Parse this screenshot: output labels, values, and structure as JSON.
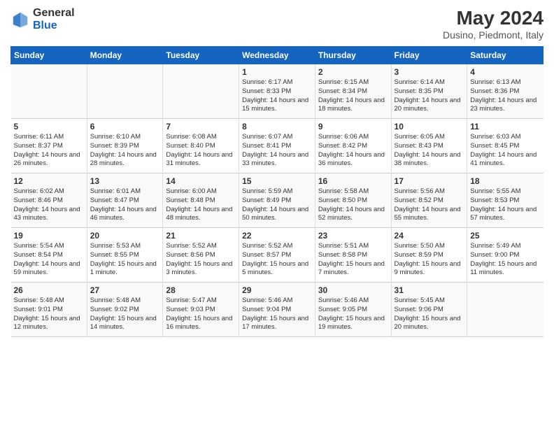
{
  "logo": {
    "general": "General",
    "blue": "Blue"
  },
  "header": {
    "month_year": "May 2024",
    "location": "Dusino, Piedmont, Italy"
  },
  "weekdays": [
    "Sunday",
    "Monday",
    "Tuesday",
    "Wednesday",
    "Thursday",
    "Friday",
    "Saturday"
  ],
  "rows": [
    [
      {
        "day": "",
        "text": ""
      },
      {
        "day": "",
        "text": ""
      },
      {
        "day": "",
        "text": ""
      },
      {
        "day": "1",
        "text": "Sunrise: 6:17 AM\nSunset: 8:33 PM\nDaylight: 14 hours\nand 15 minutes."
      },
      {
        "day": "2",
        "text": "Sunrise: 6:15 AM\nSunset: 8:34 PM\nDaylight: 14 hours\nand 18 minutes."
      },
      {
        "day": "3",
        "text": "Sunrise: 6:14 AM\nSunset: 8:35 PM\nDaylight: 14 hours\nand 20 minutes."
      },
      {
        "day": "4",
        "text": "Sunrise: 6:13 AM\nSunset: 8:36 PM\nDaylight: 14 hours\nand 23 minutes."
      }
    ],
    [
      {
        "day": "5",
        "text": "Sunrise: 6:11 AM\nSunset: 8:37 PM\nDaylight: 14 hours\nand 26 minutes."
      },
      {
        "day": "6",
        "text": "Sunrise: 6:10 AM\nSunset: 8:39 PM\nDaylight: 14 hours\nand 28 minutes."
      },
      {
        "day": "7",
        "text": "Sunrise: 6:08 AM\nSunset: 8:40 PM\nDaylight: 14 hours\nand 31 minutes."
      },
      {
        "day": "8",
        "text": "Sunrise: 6:07 AM\nSunset: 8:41 PM\nDaylight: 14 hours\nand 33 minutes."
      },
      {
        "day": "9",
        "text": "Sunrise: 6:06 AM\nSunset: 8:42 PM\nDaylight: 14 hours\nand 36 minutes."
      },
      {
        "day": "10",
        "text": "Sunrise: 6:05 AM\nSunset: 8:43 PM\nDaylight: 14 hours\nand 38 minutes."
      },
      {
        "day": "11",
        "text": "Sunrise: 6:03 AM\nSunset: 8:45 PM\nDaylight: 14 hours\nand 41 minutes."
      }
    ],
    [
      {
        "day": "12",
        "text": "Sunrise: 6:02 AM\nSunset: 8:46 PM\nDaylight: 14 hours\nand 43 minutes."
      },
      {
        "day": "13",
        "text": "Sunrise: 6:01 AM\nSunset: 8:47 PM\nDaylight: 14 hours\nand 46 minutes."
      },
      {
        "day": "14",
        "text": "Sunrise: 6:00 AM\nSunset: 8:48 PM\nDaylight: 14 hours\nand 48 minutes."
      },
      {
        "day": "15",
        "text": "Sunrise: 5:59 AM\nSunset: 8:49 PM\nDaylight: 14 hours\nand 50 minutes."
      },
      {
        "day": "16",
        "text": "Sunrise: 5:58 AM\nSunset: 8:50 PM\nDaylight: 14 hours\nand 52 minutes."
      },
      {
        "day": "17",
        "text": "Sunrise: 5:56 AM\nSunset: 8:52 PM\nDaylight: 14 hours\nand 55 minutes."
      },
      {
        "day": "18",
        "text": "Sunrise: 5:55 AM\nSunset: 8:53 PM\nDaylight: 14 hours\nand 57 minutes."
      }
    ],
    [
      {
        "day": "19",
        "text": "Sunrise: 5:54 AM\nSunset: 8:54 PM\nDaylight: 14 hours\nand 59 minutes."
      },
      {
        "day": "20",
        "text": "Sunrise: 5:53 AM\nSunset: 8:55 PM\nDaylight: 15 hours\nand 1 minute."
      },
      {
        "day": "21",
        "text": "Sunrise: 5:52 AM\nSunset: 8:56 PM\nDaylight: 15 hours\nand 3 minutes."
      },
      {
        "day": "22",
        "text": "Sunrise: 5:52 AM\nSunset: 8:57 PM\nDaylight: 15 hours\nand 5 minutes."
      },
      {
        "day": "23",
        "text": "Sunrise: 5:51 AM\nSunset: 8:58 PM\nDaylight: 15 hours\nand 7 minutes."
      },
      {
        "day": "24",
        "text": "Sunrise: 5:50 AM\nSunset: 8:59 PM\nDaylight: 15 hours\nand 9 minutes."
      },
      {
        "day": "25",
        "text": "Sunrise: 5:49 AM\nSunset: 9:00 PM\nDaylight: 15 hours\nand 11 minutes."
      }
    ],
    [
      {
        "day": "26",
        "text": "Sunrise: 5:48 AM\nSunset: 9:01 PM\nDaylight: 15 hours\nand 12 minutes."
      },
      {
        "day": "27",
        "text": "Sunrise: 5:48 AM\nSunset: 9:02 PM\nDaylight: 15 hours\nand 14 minutes."
      },
      {
        "day": "28",
        "text": "Sunrise: 5:47 AM\nSunset: 9:03 PM\nDaylight: 15 hours\nand 16 minutes."
      },
      {
        "day": "29",
        "text": "Sunrise: 5:46 AM\nSunset: 9:04 PM\nDaylight: 15 hours\nand 17 minutes."
      },
      {
        "day": "30",
        "text": "Sunrise: 5:46 AM\nSunset: 9:05 PM\nDaylight: 15 hours\nand 19 minutes."
      },
      {
        "day": "31",
        "text": "Sunrise: 5:45 AM\nSunset: 9:06 PM\nDaylight: 15 hours\nand 20 minutes."
      },
      {
        "day": "",
        "text": ""
      }
    ]
  ]
}
